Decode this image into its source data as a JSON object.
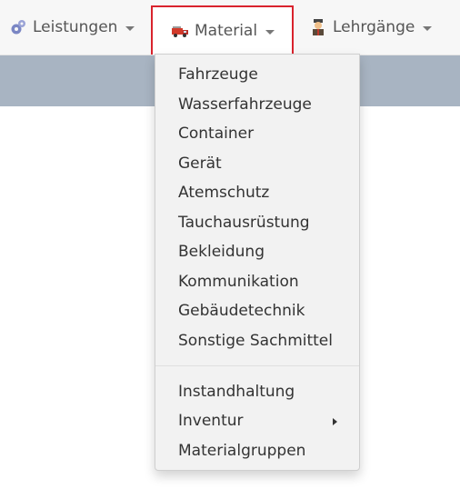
{
  "navbar": {
    "items": [
      {
        "label": "Leistungen",
        "icon": "gears-icon"
      },
      {
        "label": "Material",
        "icon": "fire-truck-icon",
        "active": true
      },
      {
        "label": "Lehrgänge",
        "icon": "instructor-icon"
      }
    ]
  },
  "dropdown": {
    "group1": [
      "Fahrzeuge",
      "Wasserfahrzeuge",
      "Container",
      "Gerät",
      "Atemschutz",
      "Tauchausrüstung",
      "Bekleidung",
      "Kommunikation",
      "Gebäudetechnik",
      "Sonstige Sachmittel"
    ],
    "group2": [
      "Instandhaltung",
      "Inventur",
      "Materialgruppen"
    ]
  },
  "colors": {
    "active_border": "#d9232d",
    "subbar": "#a8b4c2",
    "menu_bg": "#f2f2f2"
  }
}
